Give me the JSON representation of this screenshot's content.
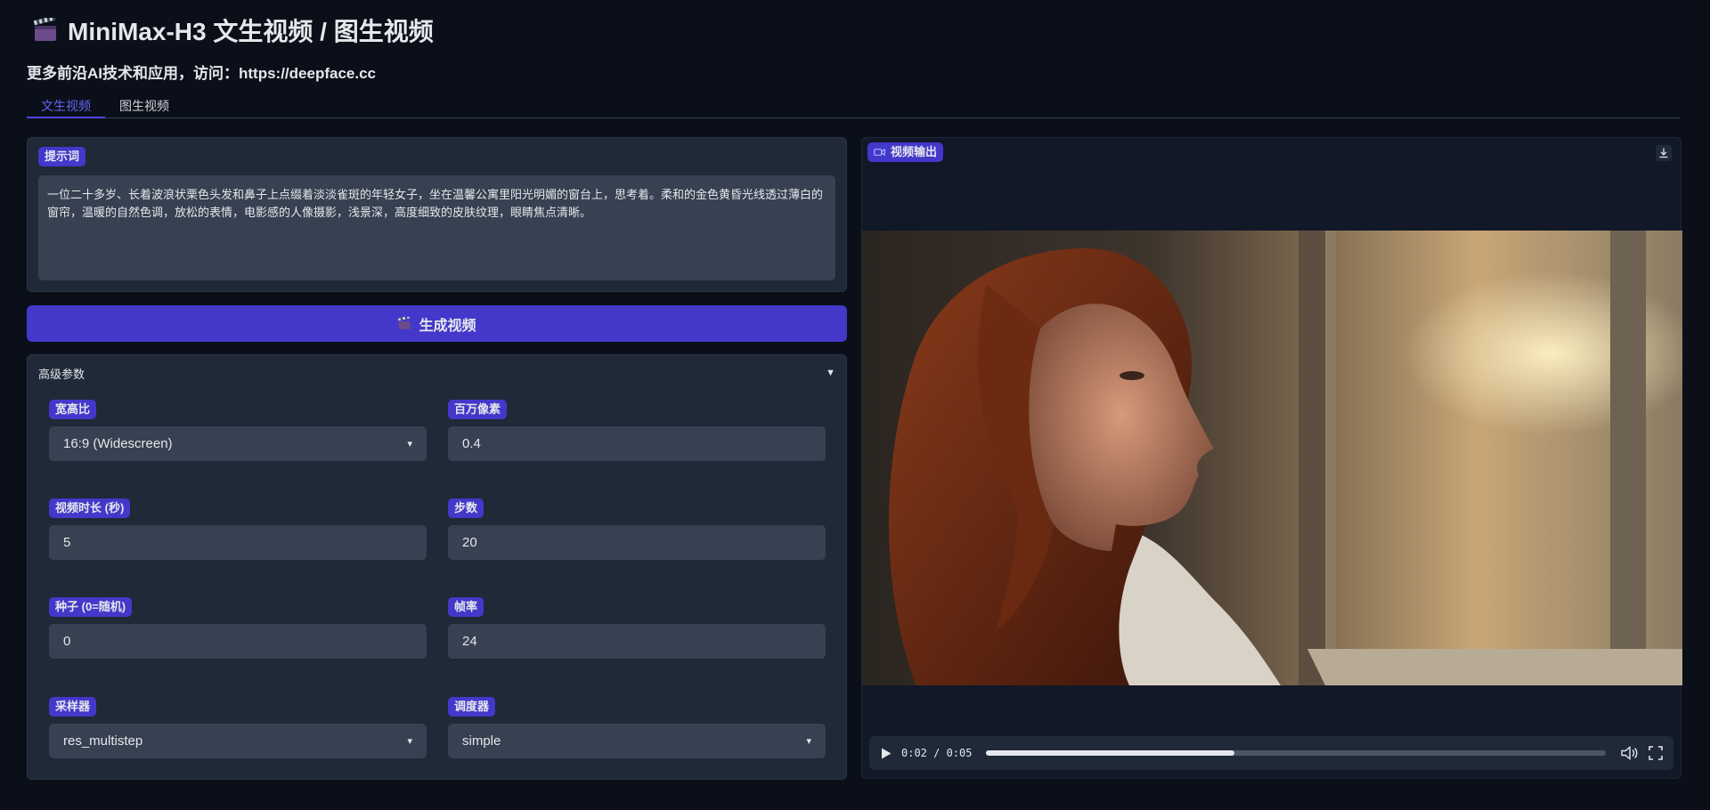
{
  "app": {
    "title": "MiniMax-H3 文生视频 / 图生视频",
    "subtitle": "更多前沿AI技术和应用，访问：https://deepface.cc"
  },
  "tabs": [
    {
      "label": "文生视频",
      "active": true
    },
    {
      "label": "图生视频",
      "active": false
    }
  ],
  "prompt": {
    "label": "提示词",
    "value": "一位二十多岁、长着波浪状栗色头发和鼻子上点缀着淡淡雀斑的年轻女子，坐在温馨公寓里阳光明媚的窗台上，思考着。柔和的金色黄昏光线透过薄白的窗帘，温暖的自然色调，放松的表情，电影感的人像摄影，浅景深，高度细致的皮肤纹理，眼睛焦点清晰。"
  },
  "generate_button": {
    "label": "生成视频",
    "icon": "clapperboard-icon"
  },
  "advanced": {
    "label": "高级参数",
    "expanded": true,
    "fields": {
      "aspect_ratio": {
        "label": "宽高比",
        "value": "16:9 (Widescreen)",
        "type": "dropdown"
      },
      "megapixels": {
        "label": "百万像素",
        "value": "0.4",
        "type": "number"
      },
      "duration": {
        "label": "视频时长 (秒)",
        "value": "5",
        "type": "number"
      },
      "steps": {
        "label": "步数",
        "value": "20",
        "type": "number"
      },
      "seed": {
        "label": "种子 (0=随机)",
        "value": "0",
        "type": "number"
      },
      "fps": {
        "label": "帧率",
        "value": "24",
        "type": "number"
      },
      "sampler": {
        "label": "采样器",
        "value": "res_multistep",
        "type": "dropdown"
      },
      "scheduler": {
        "label": "调度器",
        "value": "simple",
        "type": "dropdown"
      }
    }
  },
  "video": {
    "label": "视频输出",
    "time": "0:02 / 0:05",
    "progress": 0.4
  },
  "colors": {
    "background": "#0b0f19",
    "panel": "#1f2937",
    "accent": "#4338ca",
    "input": "#374151"
  }
}
